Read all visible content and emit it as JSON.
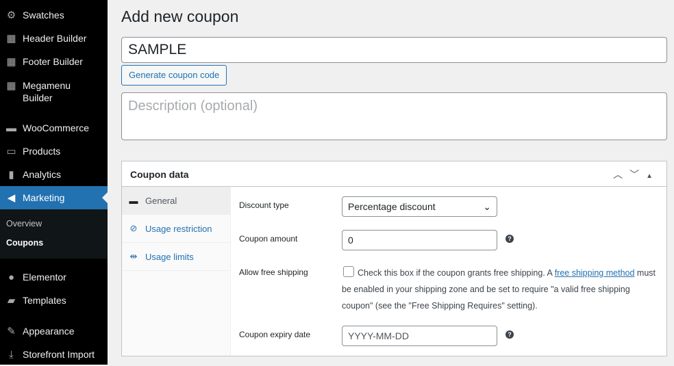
{
  "sidebar": {
    "items": [
      {
        "label": "Swatches",
        "icon": "gear-icon",
        "glyph": "⚙"
      },
      {
        "label": "Header Builder",
        "icon": "layout-icon",
        "glyph": "▦"
      },
      {
        "label": "Footer Builder",
        "icon": "layout-icon",
        "glyph": "▦"
      },
      {
        "label": "Megamenu Builder",
        "icon": "layout-icon",
        "glyph": "▦"
      },
      {
        "label": "WooCommerce",
        "icon": "woo-icon",
        "glyph": "▬"
      },
      {
        "label": "Products",
        "icon": "archive-icon",
        "glyph": "▭"
      },
      {
        "label": "Analytics",
        "icon": "bar-chart-icon",
        "glyph": "▮"
      },
      {
        "label": "Marketing",
        "icon": "megaphone-icon",
        "glyph": "📢"
      },
      {
        "label": "Elementor",
        "icon": "elementor-icon",
        "glyph": "●"
      },
      {
        "label": "Templates",
        "icon": "folder-icon",
        "glyph": "▰"
      },
      {
        "label": "Appearance",
        "icon": "brush-icon",
        "glyph": "✎"
      },
      {
        "label": "Storefront Import",
        "icon": "download-icon",
        "glyph": "⤓"
      }
    ],
    "submenu": [
      "Overview",
      "Coupons"
    ]
  },
  "page": {
    "title": "Add new coupon",
    "coupon_code": "SAMPLE",
    "generate_label": "Generate coupon code",
    "description_placeholder": "Description (optional)"
  },
  "coupon_data": {
    "title": "Coupon data",
    "tabs": [
      {
        "label": "General",
        "glyph": "▬"
      },
      {
        "label": "Usage restriction",
        "glyph": "⊘"
      },
      {
        "label": "Usage limits",
        "glyph": "⇹"
      }
    ],
    "discount_type_label": "Discount type",
    "discount_type_value": "Percentage discount",
    "amount_label": "Coupon amount",
    "amount_value": "0",
    "free_shipping_label": "Allow free shipping",
    "free_shipping_text1": "Check this box if the coupon grants free shipping. A ",
    "free_shipping_link": "free shipping method",
    "free_shipping_text2": " must be enabled in your shipping zone and be set to require \"a valid free shipping coupon\" (see the \"Free Shipping Requires\" setting).",
    "expiry_label": "Coupon expiry date",
    "expiry_placeholder": "YYYY-MM-DD"
  },
  "colors": {
    "accent": "#2271b1",
    "sidebar": "#000000"
  }
}
